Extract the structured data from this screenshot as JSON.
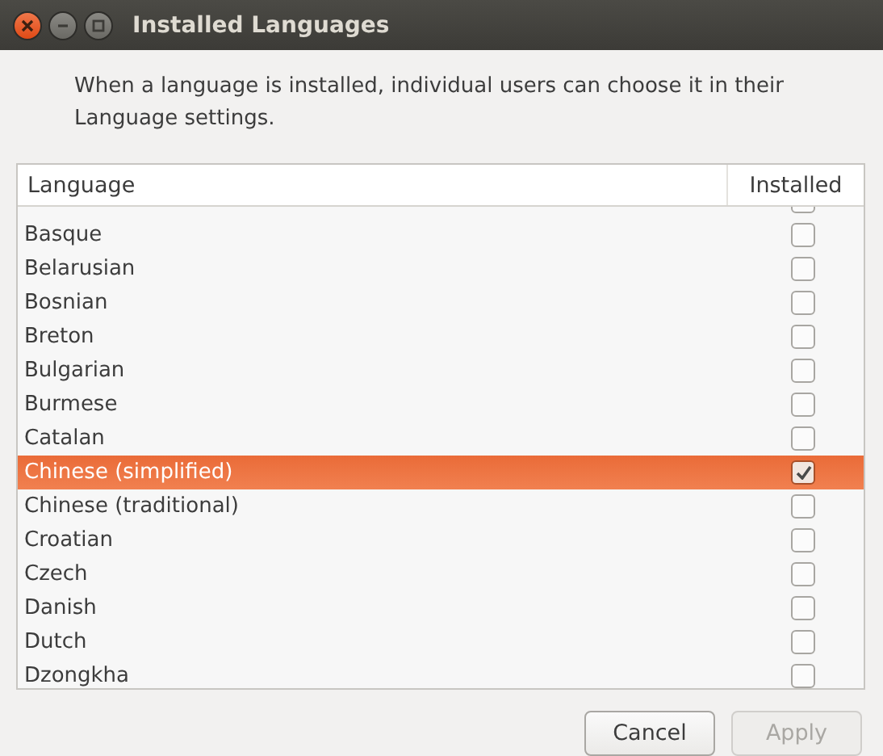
{
  "window": {
    "title": "Installed Languages"
  },
  "description": "When a language is installed, individual users can choose it in their Language settings.",
  "table": {
    "columns": [
      "Language",
      "Installed"
    ],
    "rows": [
      {
        "installed": false,
        "selected": false
      },
      {
        "language": "Basque",
        "installed": false,
        "selected": false
      },
      {
        "language": "Belarusian",
        "installed": false,
        "selected": false
      },
      {
        "language": "Bosnian",
        "installed": false,
        "selected": false
      },
      {
        "language": "Breton",
        "installed": false,
        "selected": false
      },
      {
        "language": "Bulgarian",
        "installed": false,
        "selected": false
      },
      {
        "language": "Burmese",
        "installed": false,
        "selected": false
      },
      {
        "language": "Catalan",
        "installed": false,
        "selected": false
      },
      {
        "language": "Chinese (simplified)",
        "installed": true,
        "selected": true
      },
      {
        "language": "Chinese (traditional)",
        "installed": false,
        "selected": false
      },
      {
        "language": "Croatian",
        "installed": false,
        "selected": false
      },
      {
        "language": "Czech",
        "installed": false,
        "selected": false
      },
      {
        "language": "Danish",
        "installed": false,
        "selected": false
      },
      {
        "language": "Dutch",
        "installed": false,
        "selected": false
      },
      {
        "language": "Dzongkha",
        "installed": false,
        "selected": false
      }
    ]
  },
  "buttons": [
    {
      "label": "Cancel",
      "disabled": false
    },
    {
      "label": "Apply",
      "disabled": true
    }
  ]
}
